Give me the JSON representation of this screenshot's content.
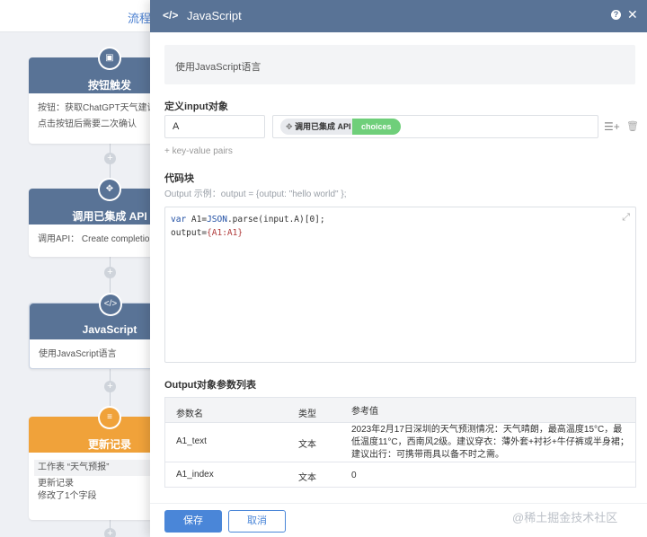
{
  "canvas": {
    "top_tab": "流程",
    "nodes": [
      {
        "title": "按钮触发",
        "lines": [
          "按钮：获取ChatGPT天气建议",
          "点击按钮后需要二次确认"
        ]
      },
      {
        "title": "调用已集成 API",
        "lines": [
          "调用API： Create completion ☑"
        ]
      },
      {
        "title": "JavaScript",
        "lines": [
          "使用JavaScript语言"
        ]
      },
      {
        "title": "更新记录",
        "lines": [
          "工作表 “天气预报”",
          "更新记录",
          "修改了1个字段"
        ]
      }
    ],
    "colors": {
      "node_header": "#597396",
      "update_header": "#f0a23a"
    }
  },
  "panel": {
    "code_icon": "</>",
    "title": "JavaScript",
    "help_icon": "?",
    "close_icon": "✕",
    "description": "使用JavaScript语言",
    "input_section_label": "定义input对象",
    "input_key": "A",
    "chip_label": "调用已集成 API",
    "chip_tag": "choices",
    "list_add_icon": "☰+",
    "trash_icon": "🗑",
    "kv_link": "+ key-value pairs",
    "code_section_label": "代码块",
    "code_hint": "Output 示例：output = {output: \"hello world\" };",
    "code_lines": {
      "l1_kw": "var ",
      "l1_id": "A1=",
      "l1_fn": "JSON",
      "l1_rest": ".parse(input.A)[0];",
      "l2_id": "output=",
      "l2_rest": "{A1:A1}"
    },
    "expand_icon": "⤢",
    "output_section_label": "Output对象参数列表",
    "table": {
      "headers": [
        "参数名",
        "类型",
        "参考值"
      ],
      "rows": [
        {
          "name": "A1_text",
          "type": "文本",
          "value": "2023年2月17日深圳的天气预测情况：天气晴朗，最高温度15°C，最低温度11°C，西南风2级。建议穿衣：薄外套+衬衫+牛仔裤或半身裙；建议出行：可携带雨具以备不时之需。"
        },
        {
          "name": "A1_index",
          "type": "文本",
          "value": "0"
        }
      ]
    },
    "save_label": "保存",
    "cancel_label": "取消",
    "accent": "#4a86d8"
  },
  "watermark": "@稀土掘金技术社区"
}
